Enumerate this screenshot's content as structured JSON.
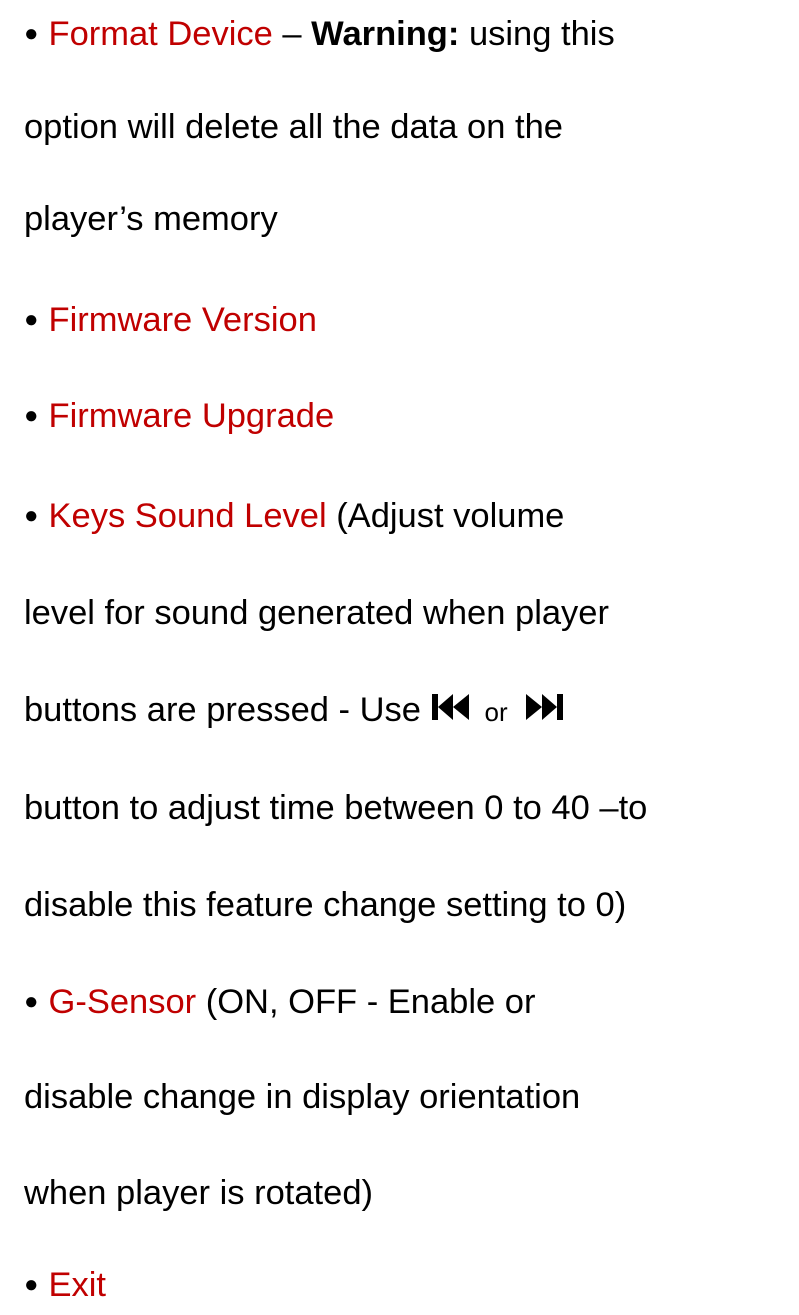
{
  "bullet_char": "●",
  "items": [
    {
      "name": "format-device",
      "label": "Format Device",
      "dash": " – ",
      "warning_label": "Warning:",
      "text_1": " using this",
      "text_2": "option will delete all the data on the",
      "text_3": "player’s memory"
    },
    {
      "name": "firmware-version",
      "label": "Firmware Version"
    },
    {
      "name": "firmware-upgrade",
      "label": "Firmware Upgrade"
    },
    {
      "name": "keys-sound-level",
      "label": "Keys Sound Level",
      "text_1": " (Adjust volume",
      "text_2": "level for sound generated when player",
      "text_3a": "buttons are pressed - Use ",
      "or_text": "or",
      "prev_icon": "previous-track-icon",
      "next_icon": "next-track-icon",
      "text_4": "button to adjust time between 0 to 40 –to",
      "text_5": "disable this feature change setting to 0)"
    },
    {
      "name": "g-sensor",
      "label": "G-Sensor",
      "text_1": " (ON, OFF - Enable or",
      "text_2": "disable change in display orientation",
      "text_3": "when player is rotated)"
    },
    {
      "name": "exit",
      "label": "Exit"
    }
  ],
  "colors": {
    "menu_item": "#c00000",
    "text": "#000000"
  }
}
